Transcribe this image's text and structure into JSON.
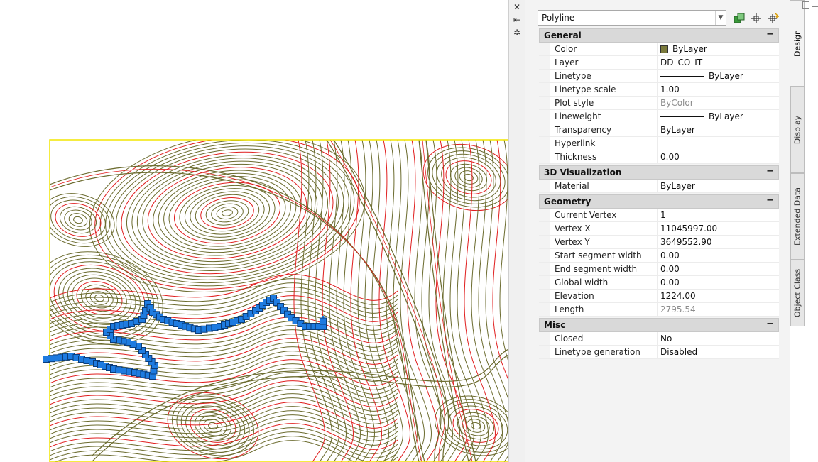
{
  "palette": {
    "close_glyph": "✕",
    "pin_glyph": "⇤",
    "settings_glyph": "✲"
  },
  "selector": {
    "value": "Polyline"
  },
  "toolbar_icons": [
    "toggle-pickadd-icon",
    "select-objects-icon",
    "quick-select-icon"
  ],
  "sections": [
    {
      "title": "General",
      "toggle": "−",
      "rows": [
        {
          "label": "Color",
          "value": "ByLayer",
          "kind": "color"
        },
        {
          "label": "Layer",
          "value": "DD_CO_IT"
        },
        {
          "label": "Linetype",
          "value": "ByLayer",
          "kind": "linetype"
        },
        {
          "label": "Linetype scale",
          "value": "1.00"
        },
        {
          "label": "Plot style",
          "value": "ByColor",
          "dim": true
        },
        {
          "label": "Lineweight",
          "value": "ByLayer",
          "kind": "linetype"
        },
        {
          "label": "Transparency",
          "value": "ByLayer"
        },
        {
          "label": "Hyperlink",
          "value": ""
        },
        {
          "label": "Thickness",
          "value": "0.00"
        }
      ]
    },
    {
      "title": "3D Visualization",
      "toggle": "−",
      "rows": [
        {
          "label": "Material",
          "value": "ByLayer"
        }
      ]
    },
    {
      "title": "Geometry",
      "toggle": "−",
      "rows": [
        {
          "label": "Current Vertex",
          "value": "1"
        },
        {
          "label": "Vertex X",
          "value": "11045997.00"
        },
        {
          "label": "Vertex Y",
          "value": "3649552.90"
        },
        {
          "label": "Start segment width",
          "value": "0.00"
        },
        {
          "label": "End segment width",
          "value": "0.00"
        },
        {
          "label": "Global width",
          "value": "0.00"
        },
        {
          "label": "Elevation",
          "value": "1224.00"
        },
        {
          "label": "Length",
          "value": "2795.54",
          "dim": true
        }
      ]
    },
    {
      "title": "Misc",
      "toggle": "−",
      "rows": [
        {
          "label": "Closed",
          "value": "No"
        },
        {
          "label": "Linetype generation",
          "value": "Disabled"
        }
      ]
    }
  ],
  "tabs": [
    {
      "label": "Design",
      "active": true
    },
    {
      "label": "Display",
      "active": false
    },
    {
      "label": "Extended Data",
      "active": false
    },
    {
      "label": "Object Class",
      "active": false
    }
  ],
  "colors": {
    "contour_olive": "#6b6b2e",
    "contour_red": "#e01e1e",
    "selection_blue": "#1e7be0",
    "viewport_border": "#f2e600"
  }
}
